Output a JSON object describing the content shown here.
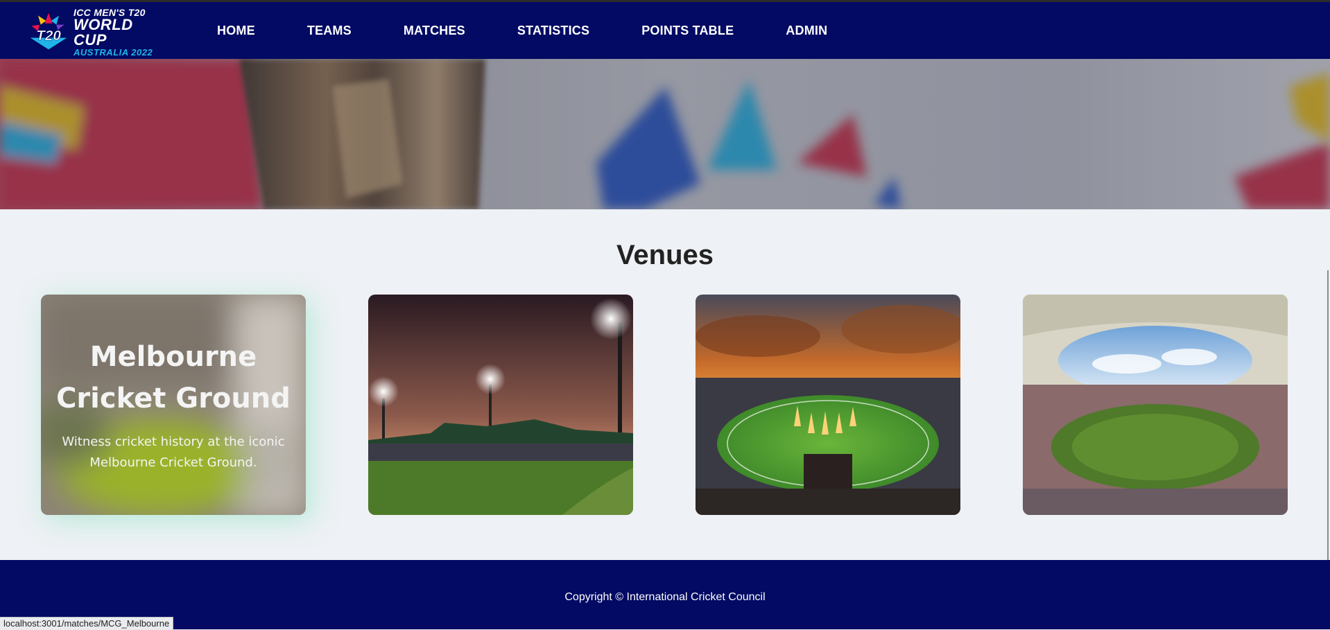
{
  "brand": {
    "logo_mark": "T20",
    "line1": "ICC MEN'S T20",
    "line2": "WORLD CUP",
    "line3": "AUSTRALIA 2022"
  },
  "nav": {
    "items": [
      "HOME",
      "TEAMS",
      "MATCHES",
      "STATISTICS",
      "POINTS TABLE",
      "ADMIN"
    ]
  },
  "venues": {
    "title": "Venues",
    "cards": [
      {
        "name": "Melbourne Cricket Ground",
        "description": "Witness cricket history at the iconic Melbourne Cricket Ground.",
        "state": "hovered"
      },
      {
        "image": "stadium-night-photo"
      },
      {
        "image": "stadium-sunset-photo"
      },
      {
        "image": "stadium-roof-photo"
      }
    ]
  },
  "footer": {
    "copyright": "Copyright © International Cricket Council"
  },
  "status_bar": {
    "url": "localhost:3001/matches/MCG_Melbourne"
  },
  "colors": {
    "navbar": "#020a63",
    "footer": "#020a63",
    "page": "#eef1f5",
    "accent_glow": "#50dca0"
  }
}
